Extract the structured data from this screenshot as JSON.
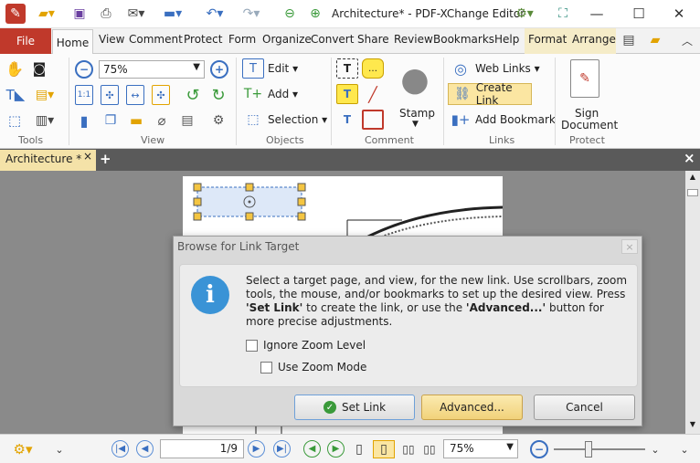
{
  "window": {
    "title": "Architecture* - PDF-XChange Editor",
    "minimize_icon": "minimize-icon",
    "maximize_icon": "maximize-icon",
    "close_icon": "close-icon"
  },
  "ribbon_tabs": [
    "File",
    "Home",
    "View",
    "Comment",
    "Protect",
    "Form",
    "Organize",
    "Convert",
    "Share",
    "Review",
    "Bookmarks",
    "Help",
    "Format",
    "Arrange"
  ],
  "ribbon": {
    "groups": {
      "tools": "Tools",
      "view": "View",
      "objects": "Objects",
      "comment": "Comment",
      "links": "Links",
      "protect": "Protect"
    },
    "zoom_value": "75%",
    "edit_label": "Edit",
    "add_label": "Add",
    "selection_label": "Selection",
    "stamp_label": "Stamp",
    "web_links_label": "Web Links",
    "create_link_label": "Create Link",
    "add_bookmark_label": "Add Bookmark",
    "sign_label_1": "Sign",
    "sign_label_2": "Document"
  },
  "document_tab": {
    "label": "Architecture *",
    "close": "×",
    "new_tab": "+",
    "close_all": "×"
  },
  "dialog": {
    "title": "Browse for Link Target",
    "close": "×",
    "message_1": "Select a target page, and view, for the new link. Use scrollbars, zoom tools, the mouse, and/or bookmarks to set up the desired view. Press ",
    "message_bold_1": "'Set Link'",
    "message_2": " to create the link, or use the ",
    "message_bold_2": "'Advanced...'",
    "message_3": " button for more precise adjustments.",
    "info_glyph": "i",
    "ignore_zoom_label": "Ignore Zoom Level",
    "use_zoom_mode_label": "Use Zoom Mode",
    "set_link_label": "Set Link",
    "advanced_label": "Advanced...",
    "cancel_label": "Cancel"
  },
  "statusbar": {
    "page_value": "1/9",
    "zoom_value": "75%"
  },
  "colors": {
    "file_tab": "#c0392b",
    "accent_yellow": "#f4e2a8",
    "info_blue": "#3a93d6"
  }
}
